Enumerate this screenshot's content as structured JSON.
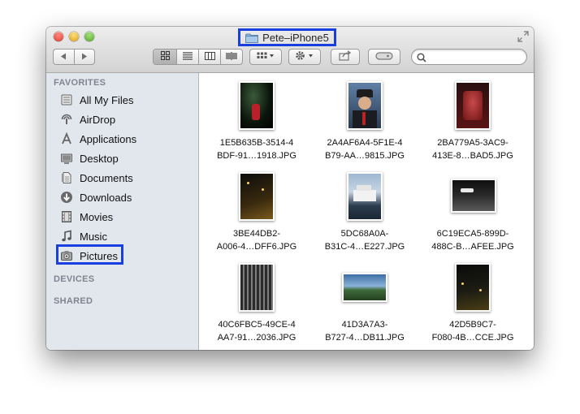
{
  "window": {
    "title": "Pete–iPhone5",
    "traffic_lights": [
      "close",
      "minimize",
      "zoom"
    ]
  },
  "toolbar": {
    "back_icon": "back-arrow-icon",
    "forward_icon": "forward-arrow-icon",
    "view_modes": [
      "icon-view",
      "list-view",
      "column-view",
      "cover-flow-view"
    ],
    "active_view": "icon-view",
    "arrange_icon": "arrange-grid-icon",
    "action_icon": "gear-icon",
    "share_icon": "share-icon",
    "tags_icon": "tag-icon",
    "search_placeholder": ""
  },
  "sidebar": {
    "favorites_header": "FAVORITES",
    "devices_header": "DEVICES",
    "shared_header": "SHARED",
    "items": [
      {
        "label": "All My Files",
        "icon": "all-files-icon"
      },
      {
        "label": "AirDrop",
        "icon": "airdrop-icon"
      },
      {
        "label": "Applications",
        "icon": "applications-icon"
      },
      {
        "label": "Desktop",
        "icon": "desktop-icon"
      },
      {
        "label": "Documents",
        "icon": "documents-icon"
      },
      {
        "label": "Downloads",
        "icon": "downloads-icon"
      },
      {
        "label": "Movies",
        "icon": "movies-icon"
      },
      {
        "label": "Music",
        "icon": "music-icon"
      },
      {
        "label": "Pictures",
        "icon": "camera-icon"
      }
    ],
    "selected": "Pictures"
  },
  "files": [
    {
      "line1": "1E5B635B-3514-4",
      "line2": "BDF-91…1918.JPG"
    },
    {
      "line1": "2A4AF6A4-5F1E-4",
      "line2": "B79-AA…9815.JPG"
    },
    {
      "line1": "2BA779A5-3AC9-",
      "line2": "413E-8…BAD5.JPG"
    },
    {
      "line1": "3BE44DB2-",
      "line2": "A006-4…DFF6.JPG"
    },
    {
      "line1": "5DC68A0A-",
      "line2": "B31C-4…E227.JPG"
    },
    {
      "line1": "6C19ECA5-899D-",
      "line2": "488C-B…AFEE.JPG"
    },
    {
      "line1": "40C6FBC5-49CE-4",
      "line2": "AA7-91…2036.JPG"
    },
    {
      "line1": "41D3A7A3-",
      "line2": "B727-4…DB11.JPG"
    },
    {
      "line1": "42D5B9C7-",
      "line2": "F080-4B…CCE.JPG"
    }
  ],
  "colors": {
    "highlight_box": "#1a3fe0",
    "sidebar_bg": "#e2e7ed",
    "section_header": "#7e8691"
  }
}
